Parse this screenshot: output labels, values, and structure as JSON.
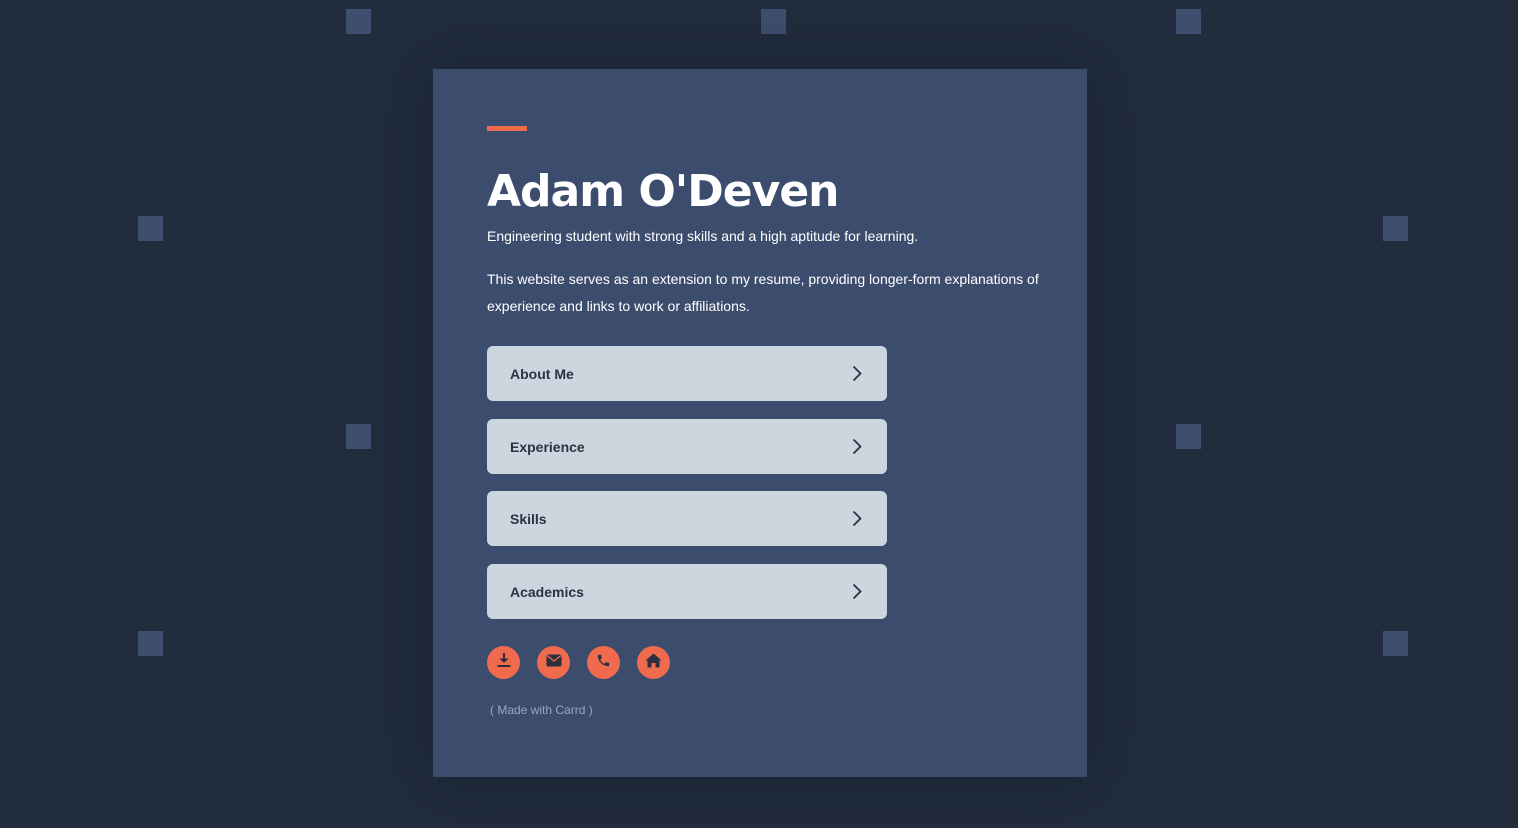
{
  "profile": {
    "name": "Adam O'Deven",
    "tagline": "Engineering student with strong skills and a high aptitude for learning.",
    "description": "This website serves as an extension to my resume, providing longer-form explanations of experience and links to work or affiliations."
  },
  "nav": [
    {
      "label": "About Me",
      "icon": "chevron-right-icon"
    },
    {
      "label": "Experience",
      "icon": "chevron-right-icon"
    },
    {
      "label": "Skills",
      "icon": "chevron-right-icon"
    },
    {
      "label": "Academics",
      "icon": "chevron-right-icon"
    }
  ],
  "social_icons": [
    "download-icon",
    "envelope-icon",
    "phone-icon",
    "home-icon"
  ],
  "footer": {
    "credit": "( Made with Carrd )"
  },
  "colors": {
    "background": "#212c3d",
    "card": "#3c4c6d",
    "accent": "#f06a4e",
    "button": "#cbd6de",
    "button_text": "#2b3244"
  }
}
